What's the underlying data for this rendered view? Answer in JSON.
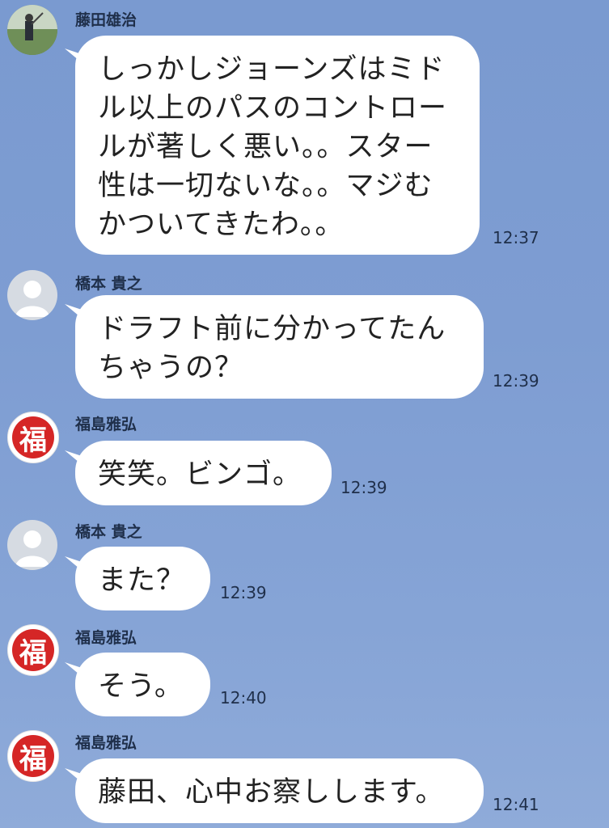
{
  "messages": [
    {
      "sender": "藤田雄治",
      "avatar": "photo-avatar",
      "text": "しっかしジョーンズはミドル以上のパスのコントロールが著しく悪い。。スター性は一切ないな。。マジむかついてきたわ。。",
      "lines": [
        "しっかしジョーンズはミド",
        "ル以上のパスのコントロー",
        "ルが著しく悪い。。スター",
        "性は一切ないな。。マジむ",
        "かついてきたわ。。"
      ],
      "time": "12:37"
    },
    {
      "sender": "橋本 貴之",
      "avatar": "default-user-avatar",
      "text": "ドラフト前に分かってたんちゃうの？",
      "lines": [
        "ドラフト前に分かってたん",
        "ちゃうの？"
      ],
      "time": "12:39"
    },
    {
      "sender": "福島雅弘",
      "avatar": "fuku-avatar",
      "avatar_char": "福",
      "text": "笑笑。ビンゴ。",
      "lines": [
        "笑笑。ビンゴ。"
      ],
      "time": "12:39"
    },
    {
      "sender": "橋本 貴之",
      "avatar": "default-user-avatar",
      "text": "また？",
      "lines": [
        "また？"
      ],
      "time": "12:39"
    },
    {
      "sender": "福島雅弘",
      "avatar": "fuku-avatar",
      "avatar_char": "福",
      "text": "そう。",
      "lines": [
        "そう。"
      ],
      "time": "12:40"
    },
    {
      "sender": "福島雅弘",
      "avatar": "fuku-avatar",
      "avatar_char": "福",
      "text": "藤田、心中お察しします。",
      "lines": [
        "藤田、心中お察しします。"
      ],
      "time": "12:41"
    }
  ],
  "colors": {
    "background": "#7e9dd2",
    "bubble": "#ffffff",
    "fuku_red": "#d52626"
  }
}
